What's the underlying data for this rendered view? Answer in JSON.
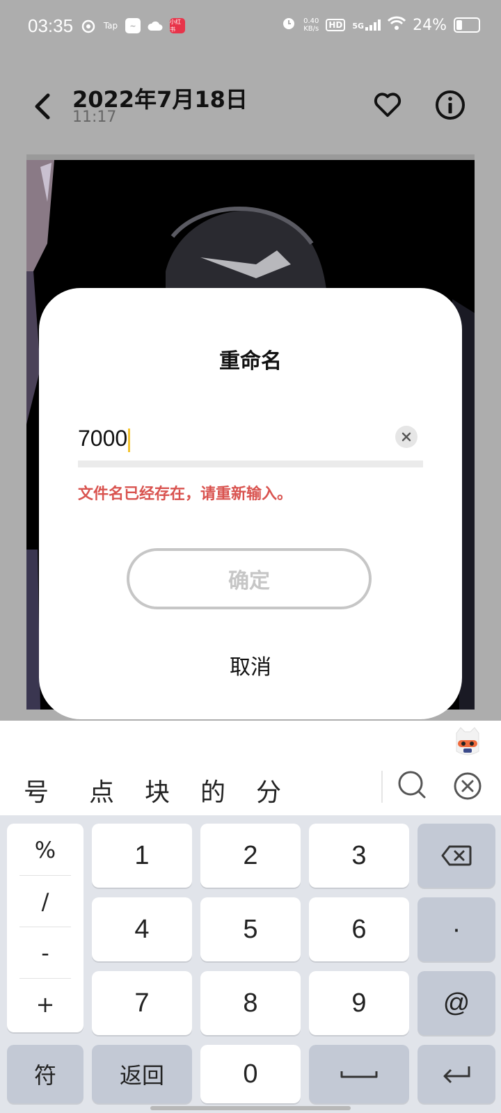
{
  "status_bar": {
    "time": "03:35",
    "left_icons": [
      "app-icon-swirl",
      "Tap",
      "app-icon-square",
      "cloud-icon",
      "小红书"
    ],
    "net_speed_value": "0.40",
    "net_speed_unit": "KB/s",
    "hd": "HD",
    "signal": "5G",
    "battery": "24%"
  },
  "header": {
    "title": "2022年7月18日",
    "subtitle": "11:17"
  },
  "dialog": {
    "title": "重命名",
    "input_value": "7000",
    "error": "文件名已经存在，请重新输入。",
    "confirm": "确定",
    "cancel": "取消"
  },
  "keyboard": {
    "candidates": [
      "号",
      "点",
      "块",
      "的",
      "分"
    ],
    "symbols": [
      "%",
      "/",
      "-",
      "+"
    ],
    "digits": [
      "1",
      "2",
      "3",
      "4",
      "5",
      "6",
      "7",
      "8",
      "9",
      "0"
    ],
    "dot": "·",
    "at": "@",
    "fu": "符",
    "back": "返回"
  },
  "colors": {
    "error": "#d9534f",
    "caret": "#f4c430",
    "disabled": "#c6c6c6"
  }
}
